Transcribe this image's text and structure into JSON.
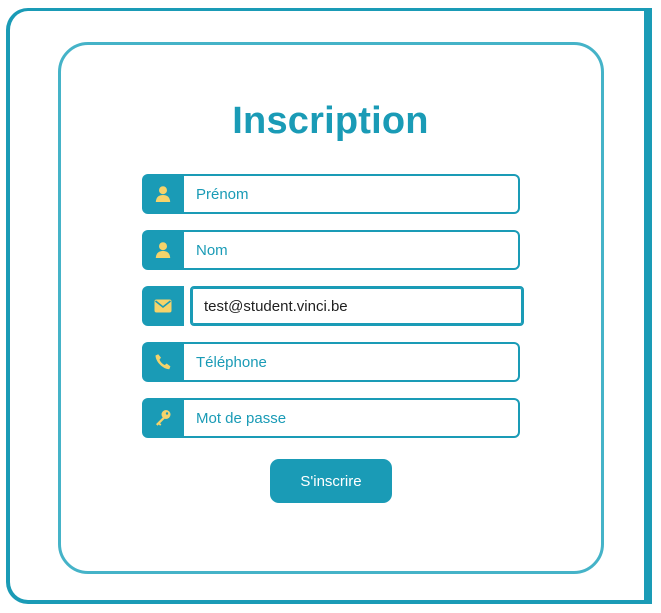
{
  "form": {
    "title": "Inscription",
    "fields": [
      {
        "placeholder": "Prénom",
        "value": "",
        "icon": "user-icon"
      },
      {
        "placeholder": "Nom",
        "value": "",
        "icon": "user-icon"
      },
      {
        "placeholder": "",
        "value": "test@student.vinci.be",
        "icon": "envelope-icon"
      },
      {
        "placeholder": "Téléphone",
        "value": "",
        "icon": "phone-icon"
      },
      {
        "placeholder": "Mot de passe",
        "value": "",
        "icon": "key-icon"
      }
    ],
    "submit_label": "S'inscrire"
  },
  "colors": {
    "accent": "#1a9bb6",
    "border": "#45b3c8",
    "icon": "#f5d36a"
  }
}
